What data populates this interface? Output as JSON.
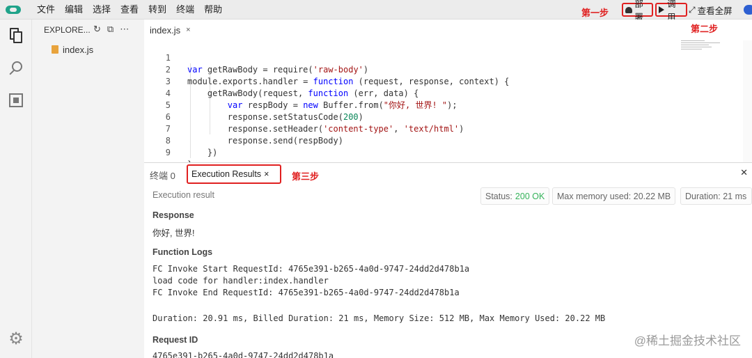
{
  "menu": [
    "文件",
    "编辑",
    "选择",
    "查看",
    "转到",
    "终端",
    "帮助"
  ],
  "toolbar": {
    "deploy_label": "部署",
    "invoke_label": "调用",
    "fullscreen_label": "查看全屏"
  },
  "annotations": {
    "step1": "第一步",
    "step2": "第二步",
    "step3": "第三步"
  },
  "sidebar": {
    "header": "EXPLORE...",
    "files": [
      "index.js"
    ]
  },
  "editor": {
    "tab_label": "index.js",
    "tab_close": "×",
    "lines": [
      "var getRawBody = require('raw-body')",
      "module.exports.handler = function (request, response, context) {",
      "    getRawBody(request, function (err, data) {",
      "        var respBody = new Buffer.from(\"你好, 世界! \");",
      "        response.setStatusCode(200)",
      "        response.setHeader('content-type', 'text/html')",
      "        response.send(respBody)",
      "    })",
      "};"
    ]
  },
  "panel": {
    "terminal_tab": "终端 0",
    "exec_tab": "Execution Results",
    "exec_tab_close": "×",
    "close": "✕",
    "exec_title": "Execution result",
    "status_label": "Status:",
    "status_value": "200 OK",
    "memory_text": "Max memory used: 20.22 MB",
    "duration_text": "Duration: 21 ms",
    "response_heading": "Response",
    "response_body": "你好, 世界!",
    "logs_heading": "Function Logs",
    "logs": [
      "FC Invoke Start RequestId: 4765e391-b265-4a0d-9747-24dd2d478b1a",
      "load code for handler:index.handler",
      "FC Invoke End RequestId: 4765e391-b265-4a0d-9747-24dd2d478b1a",
      "",
      "Duration: 20.91 ms, Billed Duration: 21 ms, Memory Size: 512 MB, Max Memory Used: 20.22 MB"
    ],
    "request_id_heading": "Request ID",
    "request_id_value": "4765e391-b265-4a0d-9747-24dd2d478b1a"
  },
  "watermark": "@稀土掘金技术社区",
  "colors": {
    "annotation_red": "#e02020",
    "status_green": "#35b35a",
    "keyword_blue": "#0000ff",
    "string_red": "#a31515"
  }
}
